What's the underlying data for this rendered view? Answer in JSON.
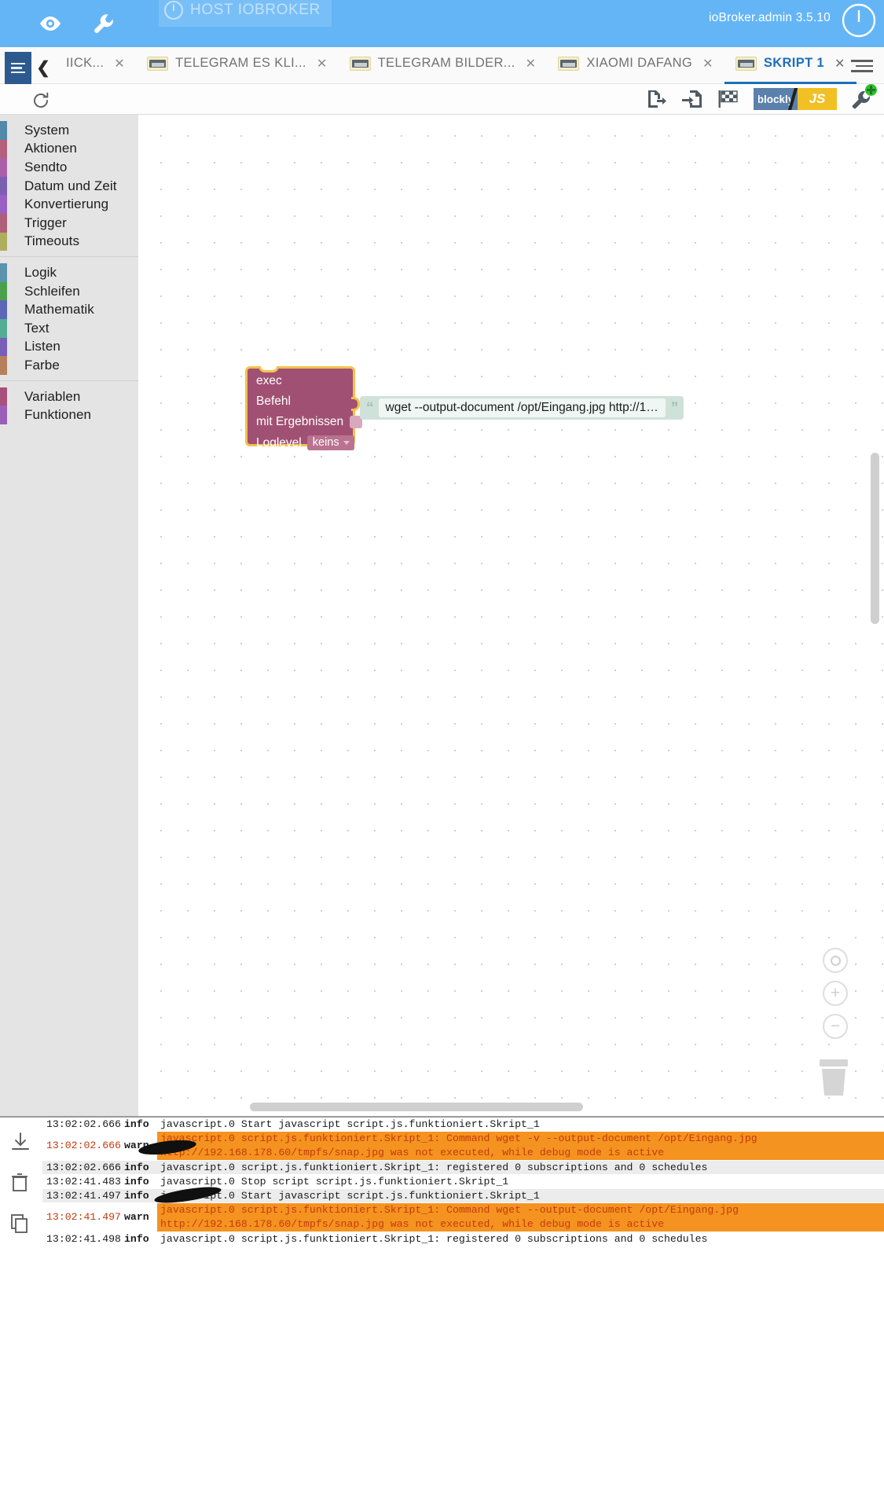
{
  "header": {
    "eye_icon": "eye-icon",
    "wrench_icon": "wrench-icon",
    "host_label": "HOST IOBROKER",
    "host_power_icon": "power-icon",
    "admin_version": "ioBroker.admin 3.5.10",
    "power_icon": "power-icon",
    "accent_color": "#64b5f6"
  },
  "tabbar": {
    "menu_icon": "hamburger-icon",
    "back_icon": "chevron-left-icon",
    "overflow_icon": "hamburger-icon",
    "tabs": [
      {
        "label": "IICK...",
        "icon": "",
        "active": false,
        "close": "✕"
      },
      {
        "label": "TELEGRAM ES KLI...",
        "icon": "script-icon",
        "active": false,
        "close": "✕"
      },
      {
        "label": "TELEGRAM BILDER...",
        "icon": "script-icon",
        "active": false,
        "close": "✕"
      },
      {
        "label": "XIAOMI DAFANG",
        "icon": "script-icon",
        "active": false,
        "close": "✕"
      },
      {
        "label": "SKRIPT 1",
        "icon": "script-icon",
        "active": true,
        "close": "✕"
      }
    ]
  },
  "editor_toolbar": {
    "refresh_icon": "refresh-icon",
    "export_icon": "export-blocks-icon",
    "import_icon": "import-blocks-icon",
    "checkered_icon": "checkered-flag-icon",
    "toggle": {
      "blockly_label": "blockly",
      "js_label": "JS",
      "blockly_color": "#5b80ab",
      "js_color": "#f0c025"
    },
    "debug_icon": "debug-wrench-icon",
    "debug_badge_color": "#2fbf2f"
  },
  "toolbox": {
    "groups": [
      {
        "items": [
          {
            "label": "System",
            "color": "#5289a8"
          },
          {
            "label": "Aktionen",
            "color": "#b4607c"
          },
          {
            "label": "Sendto",
            "color": "#ab5fa8"
          },
          {
            "label": "Datum und Zeit",
            "color": "#7b5fb0"
          },
          {
            "label": "Konvertierung",
            "color": "#9a5fc2"
          },
          {
            "label": "Trigger",
            "color": "#b05f79"
          },
          {
            "label": "Timeouts",
            "color": "#aeae5f"
          }
        ]
      },
      {
        "items": [
          {
            "label": "Logik",
            "color": "#5b93ad"
          },
          {
            "label": "Schleifen",
            "color": "#4ba14b"
          },
          {
            "label": "Mathematik",
            "color": "#5b68b8"
          },
          {
            "label": "Text",
            "color": "#53ad94"
          },
          {
            "label": "Listen",
            "color": "#7a5fb8"
          },
          {
            "label": "Farbe",
            "color": "#b5805b"
          }
        ]
      },
      {
        "items": [
          {
            "label": "Variablen",
            "color": "#a8517a"
          },
          {
            "label": "Funktionen",
            "color": "#9a5fb8"
          }
        ]
      }
    ]
  },
  "workspace": {
    "exec_block": {
      "title": "exec",
      "command_label": "Befehl",
      "results_label": "mit Ergebnissen",
      "results_checked": false,
      "loglevel_label": "Loglevel",
      "loglevel_value": "keins",
      "block_color": "#a05072",
      "highlight_color": "#f3c14f"
    },
    "text_block": {
      "value": "wget --output-document /opt/Eingang.jpg http://1…",
      "open_quote": "“",
      "close_quote": "”",
      "block_color": "#cfe2da"
    },
    "controls": {
      "center_icon": "center-target-icon",
      "zoom_in_label": "+",
      "zoom_out_label": "−",
      "trash_icon": "trash-icon",
      "hscrollbar": "horizontal-scrollbar",
      "vscrollbar": "vertical-scrollbar"
    }
  },
  "log": {
    "side_buttons": [
      {
        "icon": "download-icon"
      },
      {
        "icon": "trash-icon"
      },
      {
        "icon": "copy-icon"
      }
    ],
    "rows": [
      {
        "time": "13:02:02.666",
        "severity": "info",
        "message": "javascript.0 Start javascript script.js.funktioniert.Skript_1",
        "type": "info-a"
      },
      {
        "time": "13:02:02.666",
        "severity": "warn",
        "message_line1": "javascript.0 script.js.funktioniert.Skript_1: Command wget -v --output-document /opt/Eingang.jpg",
        "message_line2": "http://192.168.178.60/tmpfs/snap.jpg was not executed, while debug mode is active",
        "type": "warn2"
      },
      {
        "time": "13:02:02.666",
        "severity": "info",
        "message": "javascript.0 script.js.funktioniert.Skript_1: registered 0 subscriptions and 0 schedules",
        "type": "info-b"
      },
      {
        "time": "13:02:41.483",
        "severity": "info",
        "message": "javascript.0 Stop script script.js.funktioniert.Skript_1",
        "type": "info-a"
      },
      {
        "time": "13:02:41.497",
        "severity": "info",
        "message": "javascript.0 Start javascript script.js.funktioniert.Skript_1",
        "type": "info-b"
      },
      {
        "time": "13:02:41.497",
        "severity": "warn",
        "message_line1": "javascript.0 script.js.funktioniert.Skript_1: Command wget --output-document /opt/Eingang.jpg",
        "message_line2": "http://192.168.178.60/tmpfs/snap.jpg was not executed, while debug mode is active",
        "type": "warn2"
      },
      {
        "time": "13:02:41.498",
        "severity": "info",
        "message": "javascript.0 script.js.funktioniert.Skript_1: registered 0 subscriptions and 0 schedules",
        "type": "info-a"
      }
    ]
  }
}
